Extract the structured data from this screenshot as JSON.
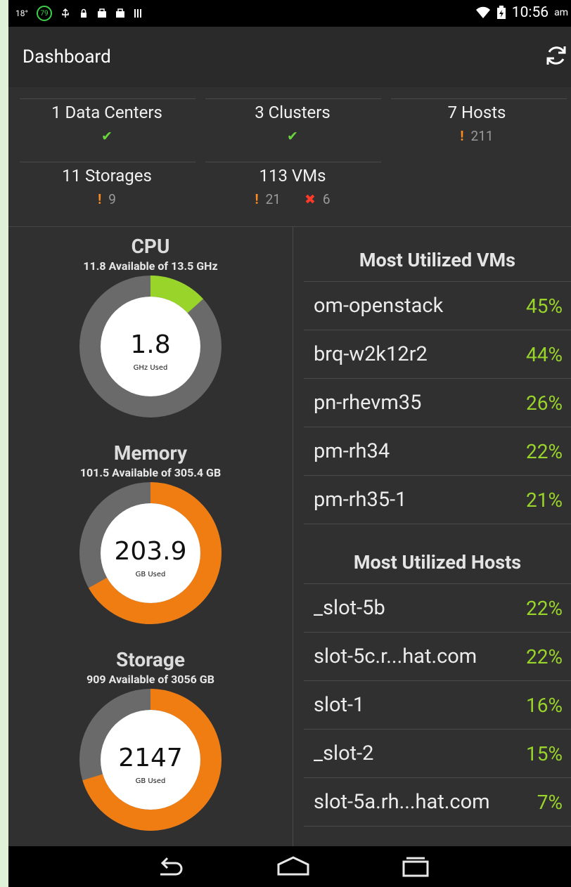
{
  "status": {
    "temp": "18°",
    "badge": "79",
    "time": "10:56",
    "ampm": "am"
  },
  "title": "Dashboard",
  "summary": [
    {
      "label": "1 Data Centers",
      "status": [
        {
          "kind": "ok",
          "text": ""
        }
      ]
    },
    {
      "label": "3 Clusters",
      "status": [
        {
          "kind": "ok",
          "text": ""
        }
      ]
    },
    {
      "label": "7 Hosts",
      "status": [
        {
          "kind": "warn",
          "text": "211"
        }
      ]
    },
    {
      "label": "11 Storages",
      "status": [
        {
          "kind": "warn",
          "text": "9"
        }
      ]
    },
    {
      "label": "113 VMs",
      "status": [
        {
          "kind": "warn",
          "text": "21"
        },
        {
          "kind": "err",
          "text": "6"
        }
      ]
    }
  ],
  "gauges": [
    {
      "title": "CPU",
      "subtitle": "11.8 Available of 13.5 GHz",
      "value": "1.8",
      "unit": "GHz Used",
      "fraction": 0.133,
      "color": "#99d42a"
    },
    {
      "title": "Memory",
      "subtitle": "101.5 Available of 305.4 GB",
      "value": "203.9",
      "unit": "GB Used",
      "fraction": 0.668,
      "color": "#f07d12"
    },
    {
      "title": "Storage",
      "subtitle": "909 Available of 3056 GB",
      "value": "2147",
      "unit": "GB Used",
      "fraction": 0.703,
      "color": "#f07d12"
    }
  ],
  "vms": {
    "header": "Most Utilized VMs",
    "rows": [
      {
        "name": "om-openstack",
        "pct": "45%"
      },
      {
        "name": "brq-w2k12r2",
        "pct": "44%"
      },
      {
        "name": "pn-rhevm35",
        "pct": "26%"
      },
      {
        "name": "pm-rh34",
        "pct": "22%"
      },
      {
        "name": "pm-rh35-1",
        "pct": "21%"
      }
    ]
  },
  "hosts": {
    "header": "Most Utilized Hosts",
    "rows": [
      {
        "name": "_slot-5b",
        "pct": "22%"
      },
      {
        "name": "slot-5c.r...hat.com",
        "pct": "22%"
      },
      {
        "name": "slot-1",
        "pct": "16%"
      },
      {
        "name": "_slot-2",
        "pct": "15%"
      },
      {
        "name": "slot-5a.rh...hat.com",
        "pct": "7%"
      }
    ]
  }
}
